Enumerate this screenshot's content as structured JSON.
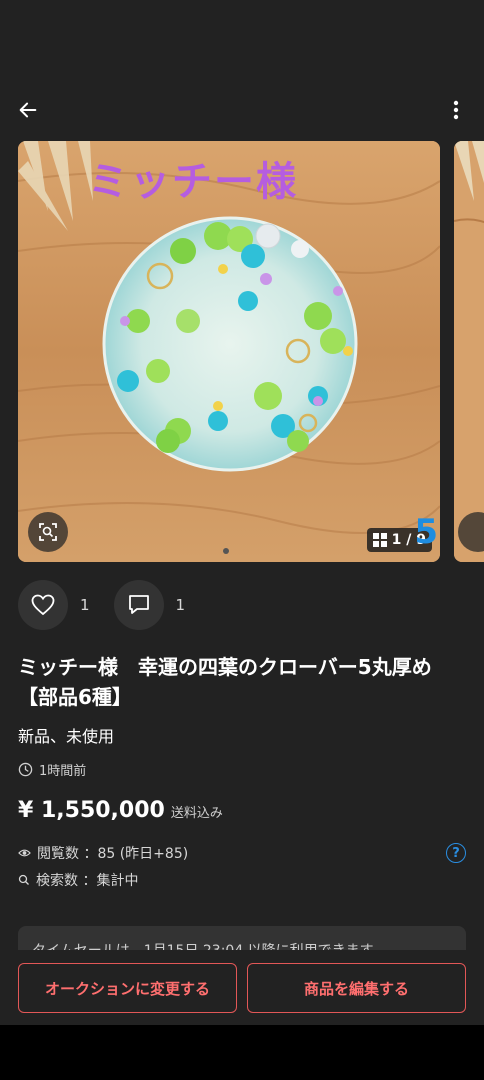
{
  "colors": {
    "background": "#222222",
    "accent_red": "#e25757",
    "link_blue": "#2a8de0",
    "overlay_purple": "#b55de0"
  },
  "header": {
    "back_icon": "arrow-left-icon",
    "more_icon": "more-vertical-icon"
  },
  "gallery": {
    "overlay_text": "ミッチー様",
    "counter": "1 / 9",
    "corner_mark": "5",
    "total_images": 9,
    "current_image": 1
  },
  "actions": {
    "like_count": "1",
    "comment_count": "1"
  },
  "product": {
    "title": "ミッチー様　幸運の四葉のクローバー5丸厚め【部品6種】",
    "condition": "新品、未使用",
    "posted": "1時間前",
    "price": "¥ 1,550,000",
    "shipping": "送料込み",
    "views": "閲覧数 ：85 (昨日+85)",
    "searches": "検索数 ：集計中",
    "help": "?"
  },
  "notice": {
    "text": "タイムセールは、1月15日 23:04 以降に利用できます"
  },
  "bottom": {
    "auction_button": "オークションに変更する",
    "edit_button": "商品を編集する"
  }
}
